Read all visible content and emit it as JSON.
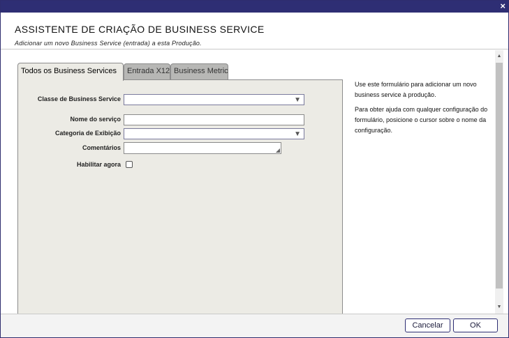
{
  "window": {
    "close_glyph": "×"
  },
  "header": {
    "title": "ASSISTENTE DE CRIAÇÃO DE BUSINESS SERVICE",
    "subtitle": "Adicionar um novo Business Service (entrada) a esta Produção."
  },
  "tabs": [
    {
      "label": "Todos os Business Services",
      "active": true
    },
    {
      "label": "Entrada X12",
      "active": false
    },
    {
      "label": "Business Metric",
      "active": false
    }
  ],
  "form": {
    "class_label": "Classe de Business Service",
    "class_value": "",
    "name_label": "Nome do serviço",
    "name_value": "",
    "category_label": "Categoria de Exibição",
    "category_value": "",
    "comments_label": "Comentários",
    "comments_value": "",
    "enable_label": "Habilitar agora",
    "enable_checked": false,
    "dropdown_arrow": "▼",
    "resize_grip": "◢"
  },
  "help": {
    "paragraph1": "Use este formulário para adicionar um novo business service à produção.",
    "paragraph2": "Para obter ajuda com qualquer configuração do formulário, posicione o cursor sobre o nome da configuração."
  },
  "scrollbar": {
    "up_glyph": "▲",
    "down_glyph": "▼"
  },
  "footer": {
    "cancel_label": "Cancelar",
    "ok_label": "OK"
  },
  "colors": {
    "titlebar": "#2e2e74",
    "panel": "#ecebe5",
    "inactive_tab": "#b7b7b5",
    "button_border": "#2e2e74"
  }
}
